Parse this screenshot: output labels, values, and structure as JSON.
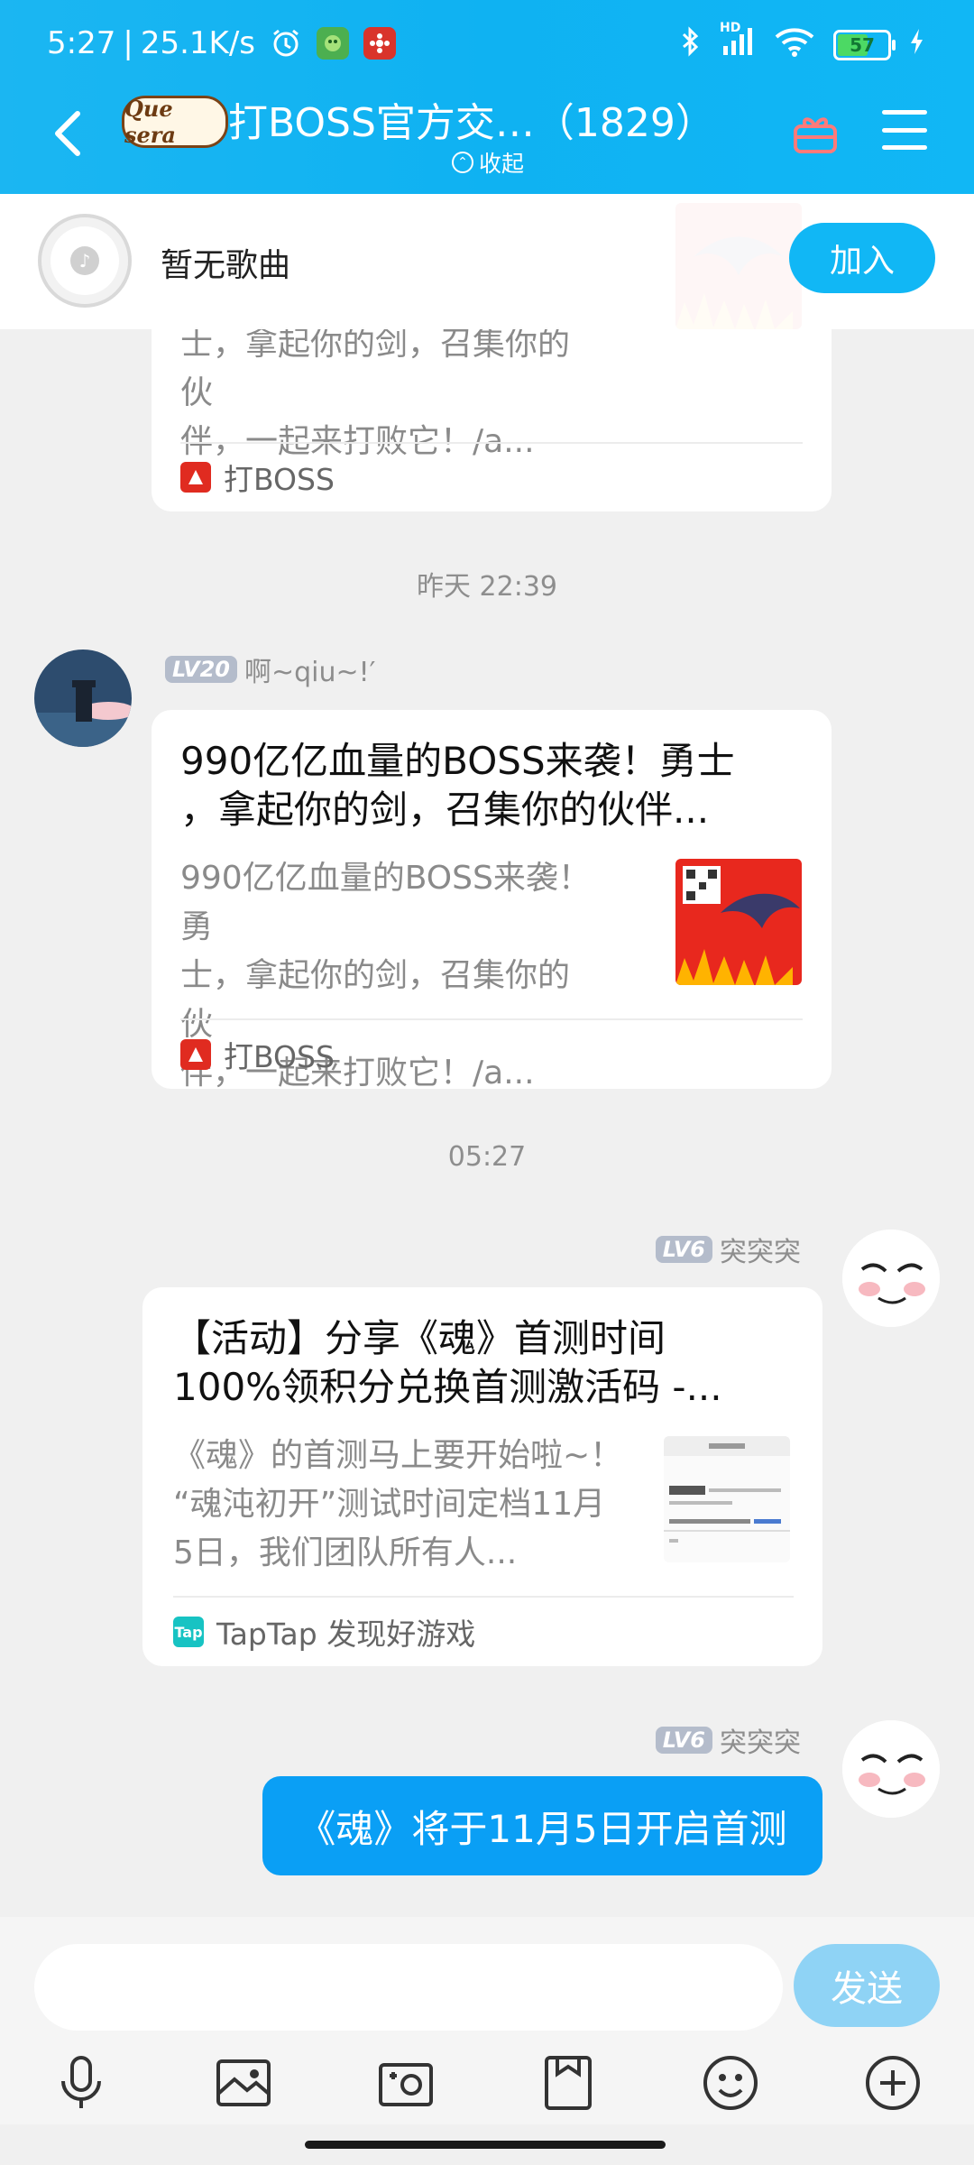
{
  "status_bar": {
    "time": "5:27",
    "separator": "|",
    "net_speed": "25.1K/s",
    "hd_label": "HD",
    "battery": "57"
  },
  "header": {
    "logo_text": "Que sera",
    "title": "打BOSS官方交…（1829）",
    "collapse_label": "收起"
  },
  "music_bar": {
    "song_text": "暂无歌曲",
    "join_label": "加入"
  },
  "messages": {
    "partial_card": {
      "body_lines": [
        "士，拿起你的剑，召集你的伙",
        "伴，一起来打败它！/a..."
      ],
      "source": "打BOSS"
    },
    "time1": "昨天 22:39",
    "msg1": {
      "level": "LV20",
      "sender": "啊~qiu~!′",
      "title_lines": [
        "990亿亿血量的BOSS来袭！勇士",
        "，拿起你的剑，召集你的伙伴..."
      ],
      "body_lines": [
        "990亿亿血量的BOSS来袭！勇",
        "士，拿起你的剑，召集你的伙",
        "伴，一起来打败它！/a..."
      ],
      "source": "打BOSS"
    },
    "time2": "05:27",
    "msg2": {
      "level": "LV6",
      "sender": "突突突",
      "title_lines": [
        "【活动】分享《魂》首测时间",
        "100%领积分兑换首测激活码 -..."
      ],
      "body_lines": [
        "《魂》的首测马上要开始啦~！",
        "“魂沌初开”测试时间定档11月",
        "5日，我们团队所有人..."
      ],
      "source": "TapTap 发现好游戏",
      "source_icon_text": "Tap"
    },
    "msg3": {
      "level": "LV6",
      "sender": "突突突",
      "text": "《魂》将于11月5日开启首测"
    }
  },
  "input": {
    "placeholder": "",
    "send_label": "发送"
  },
  "colors": {
    "header_blue": "#11b7f5",
    "bubble_blue": "#0a9ff5",
    "send_disabled": "#8fd3f5"
  },
  "icons": {
    "toolbar": [
      "microphone-icon",
      "image-icon",
      "camera-icon",
      "file-icon",
      "emoji-icon",
      "plus-icon"
    ]
  }
}
